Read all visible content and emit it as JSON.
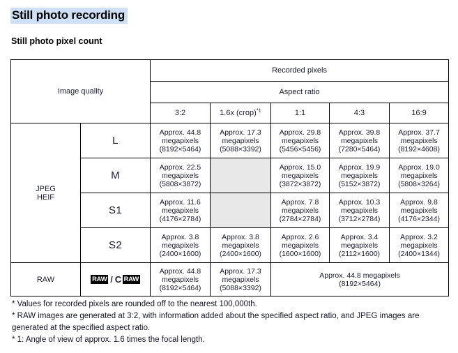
{
  "document": {
    "title": "Still photo recording",
    "section_title": "Still photo pixel count",
    "highlight_color": "#cfe0f6"
  },
  "table": {
    "header": {
      "image_quality": "Image quality",
      "recorded_pixels": "Recorded pixels",
      "aspect_ratio": "Aspect ratio",
      "columns": [
        {
          "label": "3:2",
          "footnote": ""
        },
        {
          "label": "1.6x (crop)",
          "footnote": "*1"
        },
        {
          "label": "1:1",
          "footnote": ""
        },
        {
          "label": "4:3",
          "footnote": ""
        },
        {
          "label": "16:9",
          "footnote": ""
        }
      ]
    },
    "groups": [
      {
        "name": "JPEG\nHEIF",
        "name_line1": "JPEG",
        "name_line2": "HEIF",
        "rows": [
          {
            "size": "L",
            "cells": [
              {
                "mp": "Approx. 44.8",
                "unit": "megapixels",
                "dims": "(8192×5464)",
                "empty": false
              },
              {
                "mp": "Approx. 17.3",
                "unit": "megapixels",
                "dims": "(5088×3392)",
                "empty": false
              },
              {
                "mp": "Approx. 29.8",
                "unit": "megapixels",
                "dims": "(5456×5456)",
                "empty": false
              },
              {
                "mp": "Approx. 39.8",
                "unit": "megapixels",
                "dims": "(7280×5464)",
                "empty": false
              },
              {
                "mp": "Approx. 37.7",
                "unit": "megapixels",
                "dims": "(8192×4608)",
                "empty": false
              }
            ]
          },
          {
            "size": "M",
            "cells": [
              {
                "mp": "Approx. 22.5",
                "unit": "megapixels",
                "dims": "(5808×3872)",
                "empty": false
              },
              {
                "mp": "",
                "unit": "",
                "dims": "",
                "empty": true
              },
              {
                "mp": "Approx. 15.0",
                "unit": "megapixels",
                "dims": "(3872×3872)",
                "empty": false
              },
              {
                "mp": "Approx. 19.9",
                "unit": "megapixels",
                "dims": "(5152×3872)",
                "empty": false
              },
              {
                "mp": "Approx. 19.0",
                "unit": "megapixels",
                "dims": "(5808×3264)",
                "empty": false
              }
            ]
          },
          {
            "size": "S1",
            "cells": [
              {
                "mp": "Approx. 11.6",
                "unit": "megapixels",
                "dims": "(4176×2784)",
                "empty": false
              },
              {
                "mp": "",
                "unit": "",
                "dims": "",
                "empty": true
              },
              {
                "mp": "Approx. 7.8",
                "unit": "megapixels",
                "dims": "(2784×2784)",
                "empty": false
              },
              {
                "mp": "Approx. 10.3",
                "unit": "megapixels",
                "dims": "(3712×2784)",
                "empty": false
              },
              {
                "mp": "Approx. 9.8",
                "unit": "megapixels",
                "dims": "(4176×2344)",
                "empty": false
              }
            ]
          },
          {
            "size": "S2",
            "cells": [
              {
                "mp": "Approx. 3.8",
                "unit": "megapixels",
                "dims": "(2400×1600)",
                "empty": false
              },
              {
                "mp": "Approx. 3.8",
                "unit": "megapixels",
                "dims": "(2400×1600)",
                "empty": false
              },
              {
                "mp": "Approx. 2.6",
                "unit": "megapixels",
                "dims": "(1600×1600)",
                "empty": false
              },
              {
                "mp": "Approx. 3.4",
                "unit": "megapixels",
                "dims": "(2112×1600)",
                "empty": false
              },
              {
                "mp": "Approx. 3.2",
                "unit": "megapixels",
                "dims": "(2400×1344)",
                "empty": false
              }
            ]
          }
        ]
      },
      {
        "name": "RAW",
        "rows": [
          {
            "size_badges": {
              "raw": "RAW",
              "separator": "/",
              "craw_c": "C",
              "craw_raw": "RAW"
            },
            "cells": [
              {
                "mp": "Approx. 44.8",
                "unit": "megapixels",
                "dims": "(8192×5464)",
                "empty": false
              },
              {
                "mp": "Approx. 17.3",
                "unit": "megapixels",
                "dims": "(5088×3392)",
                "empty": false
              }
            ],
            "merged_cell": {
              "mp": "Approx. 44.8 megapixels",
              "dims": "(8192×5464)"
            }
          }
        ]
      }
    ]
  },
  "notes": [
    "* Values for recorded pixels are rounded off to the nearest 100,000th.",
    "* RAW images are generated at 3:2, with information added about the specified aspect ratio, and JPEG images are generated at the specified aspect ratio.",
    "* 1: Angle of view of approx. 1.6 times the focal length."
  ]
}
